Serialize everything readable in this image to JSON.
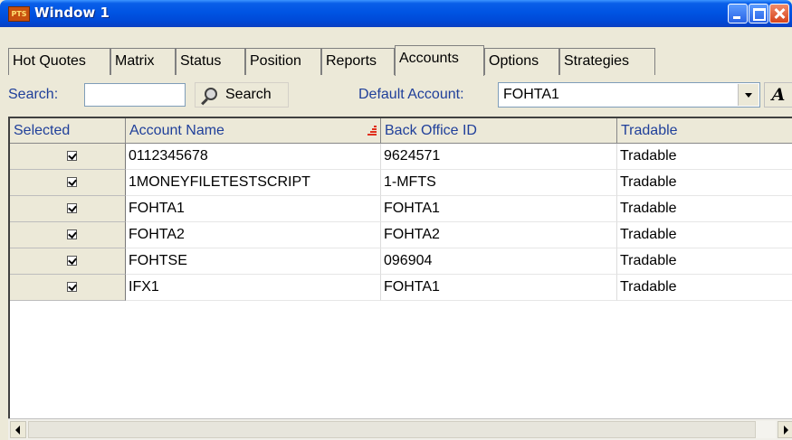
{
  "window": {
    "title": "Window 1",
    "app_icon_text": "PTS"
  },
  "tabs": [
    {
      "label": "Hot Quotes"
    },
    {
      "label": "Matrix"
    },
    {
      "label": "Status"
    },
    {
      "label": "Position"
    },
    {
      "label": "Reports"
    },
    {
      "label": "Accounts",
      "active": true
    },
    {
      "label": "Options"
    },
    {
      "label": "Strategies"
    }
  ],
  "toolbar": {
    "search_label": "Search:",
    "search_value": "",
    "search_button_label": "Search",
    "default_account_label": "Default Account:",
    "default_account_value": "FOHTA1",
    "font_button_label": "A"
  },
  "table": {
    "columns": [
      "Selected",
      "Account Name",
      "Back Office ID",
      "Tradable"
    ],
    "sorted_column": "Account Name",
    "rows": [
      {
        "selected": true,
        "account_name": "0112345678",
        "back_office_id": "9624571",
        "tradable": "Tradable"
      },
      {
        "selected": true,
        "account_name": "1MONEYFILETESTSCRIPT",
        "back_office_id": "1-MFTS",
        "tradable": "Tradable"
      },
      {
        "selected": true,
        "account_name": "FOHTA1",
        "back_office_id": "FOHTA1",
        "tradable": "Tradable"
      },
      {
        "selected": true,
        "account_name": "FOHTA2",
        "back_office_id": "FOHTA2",
        "tradable": "Tradable"
      },
      {
        "selected": true,
        "account_name": "FOHTSE",
        "back_office_id": "096904",
        "tradable": "Tradable"
      },
      {
        "selected": true,
        "account_name": "IFX1",
        "back_office_id": "FOHTA1",
        "tradable": "Tradable"
      }
    ]
  },
  "colors": {
    "title_bar": "#0054e3",
    "header_text": "#1f3f9a",
    "sort_icon": "#e0301e"
  }
}
